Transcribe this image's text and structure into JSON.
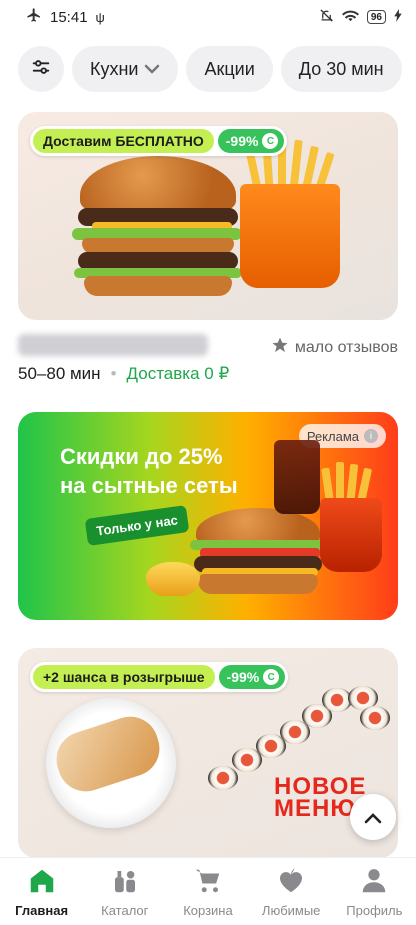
{
  "status_bar": {
    "time": "15:41",
    "usb_symbol": "ψ",
    "battery": "96"
  },
  "filters": {
    "items": [
      {
        "label": "Кухни",
        "has_chevron": true
      },
      {
        "label": "Акции"
      },
      {
        "label": "До 30 мин"
      }
    ]
  },
  "card1": {
    "promo_label": "Доставим БЕСПЛАТНО",
    "discount": "-99%",
    "coin_symbol": "С",
    "rating_text": "мало отзывов",
    "delivery_time": "50–80 мин",
    "separator": "•",
    "delivery_price": "Доставка 0 ₽"
  },
  "ad_card": {
    "badge": "Реклама",
    "info_symbol": "i",
    "title_line1": "Скидки до 25%",
    "title_line2": "на сытные сеты",
    "tag": "Только у нас"
  },
  "card3": {
    "promo_label": "+2 шанса в розыгрыше",
    "discount": "-99%",
    "coin_symbol": "С",
    "new_menu_line1": "НОВОЕ",
    "new_menu_line2": "МЕНЮ"
  },
  "scroll_top_symbol": "⌃",
  "bottom_nav": {
    "items": [
      {
        "label": "Главная",
        "active": true
      },
      {
        "label": "Каталог"
      },
      {
        "label": "Корзина"
      },
      {
        "label": "Любимые"
      },
      {
        "label": "Профиль"
      }
    ]
  },
  "colors": {
    "brand_green": "#1ea84b",
    "promo_lime": "#c4ef52",
    "discount_green": "#37c25c"
  }
}
